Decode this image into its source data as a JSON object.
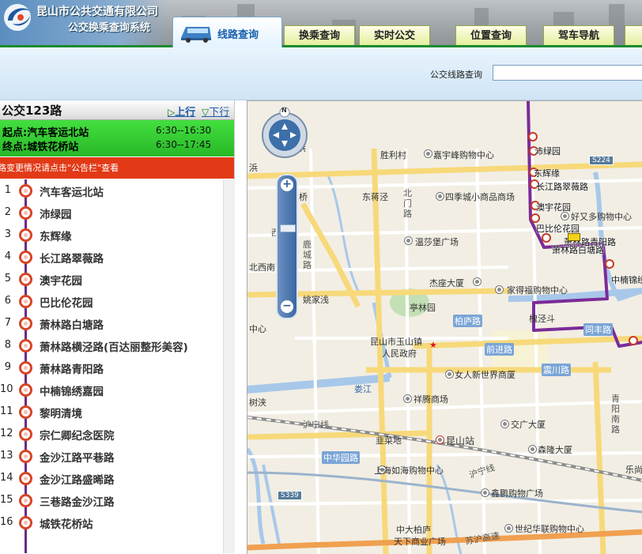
{
  "header": {
    "company": "昆山市公共交通有限公司",
    "system": "公交换乘查询系统",
    "active_tab": "线路查询",
    "tabs": [
      "换乘查询",
      "实时公交",
      "位置查询",
      "驾车导航"
    ]
  },
  "search": {
    "label": "公交线路查询",
    "value": ""
  },
  "route": {
    "name": "公交123路",
    "dir_up": "上行",
    "dir_down": "下行",
    "start_label": "起点:",
    "start": "汽车客运北站",
    "start_time": "6:30--16:30",
    "end_label": "终点:",
    "end": "城铁花桥站",
    "end_time": "6:30--17:45",
    "notice": "线路变更情况请点击\"公告栏\"查看"
  },
  "stops": [
    {
      "num": "1",
      "name": "汽车客运北站"
    },
    {
      "num": "2",
      "name": "沛绿园"
    },
    {
      "num": "3",
      "name": "东辉缘"
    },
    {
      "num": "4",
      "name": "长江路翠薇路"
    },
    {
      "num": "5",
      "name": "澳宇花园"
    },
    {
      "num": "6",
      "name": "巴比伦花园"
    },
    {
      "num": "7",
      "name": "萧林路白塘路"
    },
    {
      "num": "8",
      "name": "萧林路横泾路(百达丽整形美容)"
    },
    {
      "num": "9",
      "name": "萧林路青阳路"
    },
    {
      "num": "10",
      "name": "中楠锦绣嘉园"
    },
    {
      "num": "11",
      "name": "黎明清境"
    },
    {
      "num": "12",
      "name": "宗仁卿纪念医院"
    },
    {
      "num": "13",
      "name": "金沙江路平巷路"
    },
    {
      "num": "14",
      "name": "金沙江路盛晞路"
    },
    {
      "num": "15",
      "name": "三巷路金沙江路"
    },
    {
      "num": "16",
      "name": "城铁花桥站"
    }
  ],
  "map": {
    "compass": "N",
    "labels": {
      "shengli": "胜利村",
      "jiayu": "嘉宇峰购物中心",
      "siji": "四季城小商品商场",
      "haoyou": "好又多购物中心",
      "wenshabao": "温莎堡广场",
      "dongtang": "东蒋泾",
      "beimen": "北门路",
      "lu": "鹿城路",
      "yaojia": "姚家浅",
      "jiesha": "杰座大厦",
      "jiade": "家得福购物中心",
      "tinglin": "亭林园",
      "bolu": "柏庐路",
      "zhenxi": "西路",
      "qianjin": "前进路",
      "kunshan1": "昆山市玉山镇",
      "kunshan2": "人民政府",
      "nvren": "女人新世界商厦",
      "zhenchuan": "震川路",
      "loujiang": "娄江",
      "xiangteng": "祥腾商场",
      "huning": "沪宁线",
      "feicai": "韭菜地",
      "kszhan": "昆山站",
      "jiaoguang": "交广大厦",
      "senlong": "森隆大厦",
      "zhonghua": "中华园路",
      "shanghairu": "上海如海购物中心",
      "xinpeng": "鑫鹏购物广场",
      "zhongda": "中大柏庐",
      "tianxia": "天下商业广场",
      "shiji": "世纪华联购物中心",
      "qingyang": "青阳南路",
      "shuxi": "树浃",
      "beixi": "北西南",
      "zhongxin": "中心",
      "huaijing": "槐泾斗",
      "s224": "S224",
      "s339": "S339",
      "qiao": "桥",
      "bin": "浜",
      "caobang": "草浜",
      "lehang": "乐尚",
      "tonglu": "同丰路",
      "jiaoqiao": "苏沪高速",
      "zhonghua2": "沪宁线"
    },
    "route_labels": [
      "沛绿园",
      "东辉缘",
      "长江路翠薇路",
      "澳宇花园",
      "巴比伦花园",
      "萧林路白塘路",
      "中楠锦绣",
      "萧林路青阳路"
    ]
  }
}
